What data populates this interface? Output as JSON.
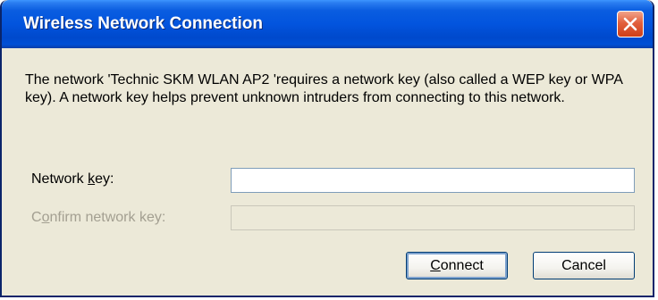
{
  "window": {
    "title": "Wireless Network Connection",
    "close_icon": "close-icon",
    "accent_color": "#0054e3",
    "close_color": "#e2603d"
  },
  "message": "The network 'Technic SKM  WLAN  AP2 'requires a network key (also called a WEP key or WPA key). A network key helps prevent unknown intruders from connecting to this network.",
  "form": {
    "network_key_label_pre": "Network ",
    "network_key_label_mnemonic": "k",
    "network_key_label_post": "ey:",
    "network_key_value": "",
    "confirm_label_pre": "C",
    "confirm_label_mnemonic": "o",
    "confirm_label_post": "nfirm network key:",
    "confirm_value": ""
  },
  "buttons": {
    "connect_mnemonic": "C",
    "connect_rest": "onnect",
    "cancel_label": "Cancel"
  }
}
